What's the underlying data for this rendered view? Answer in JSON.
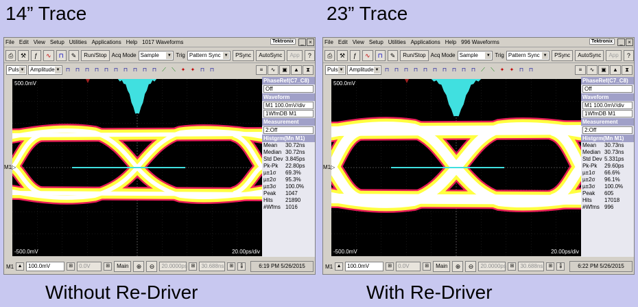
{
  "captions": {
    "left_top": "14” Trace",
    "right_top": "23” Trace",
    "left_bottom": "Without Re-Driver",
    "right_bottom": "With Re-Driver"
  },
  "colors": {
    "background": "#c8c8f0",
    "eye_hot": "#ffff40",
    "eye_core": "#ffffff",
    "eye_edge": "#ff2060",
    "histogram": "#40e0e0"
  },
  "menu": [
    "File",
    "Edit",
    "View",
    "Setup",
    "Utilities",
    "Applications",
    "Help"
  ],
  "brand": "Tektronix",
  "toolbar": {
    "run_stop": "Run/Stop",
    "acq_mode_label": "Acq Mode",
    "acq_mode_value": "Sample",
    "trig_label": "Trig",
    "trig_value": "Pattern Sync",
    "psync": "PSync",
    "autosync": "AutoSync",
    "app": "App",
    "help": "?"
  },
  "toolbar2": {
    "pulse": "Pulse",
    "amplitude": "Amplitude"
  },
  "scopes": [
    {
      "waveforms": "1017 Waveforms",
      "scale_top": "500.0mV",
      "scale_bottom": "-500.0mV",
      "time_div": "20.00ps/div",
      "panel": {
        "phaseref_title": "PhaseRef(C7_C8)",
        "phaseref_value": "Off",
        "waveform_title": "Waveform",
        "waveform_value": "M1 100.0mV/div",
        "wfmdb": "1WfmDB M1",
        "measurement_title": "Measurement",
        "measurement_value": "2:Off",
        "histogram_title": "Histgrm(Mn M1)",
        "stats": [
          {
            "k": "Mean",
            "v": "30.72ns"
          },
          {
            "k": "Median",
            "v": "30.72ns"
          },
          {
            "k": "Std Dev",
            "v": "3.845ps"
          },
          {
            "k": "Pk-Pk",
            "v": "22.80ps"
          },
          {
            "k": "µ±1σ",
            "v": "69.3%"
          },
          {
            "k": "µ±2σ",
            "v": "95.3%"
          },
          {
            "k": "µ±3σ",
            "v": "100.0%"
          },
          {
            "k": "Peak",
            "v": "1047"
          },
          {
            "k": "Hits",
            "v": "21890"
          },
          {
            "k": "#Wfms",
            "v": "1016"
          }
        ]
      },
      "bottom": {
        "m1": "M1",
        "vdiv": "100.0mV",
        "offset": "0.0V",
        "main": "Main",
        "time1": "20.0000ps",
        "time2": "30.688ns",
        "timestamp": "6:19 PM 5/26/2015"
      }
    },
    {
      "waveforms": "996 Waveforms",
      "scale_top": "500.0mV",
      "scale_bottom": "-500.0mV",
      "time_div": "20.00ps/div",
      "panel": {
        "phaseref_title": "PhaseRef(C7_C8)",
        "phaseref_value": "Off",
        "waveform_title": "Waveform",
        "waveform_value": "M1 100.0mV/div",
        "wfmdb": "1WfmDB M1",
        "measurement_title": "Measurement",
        "measurement_value": "2:Off",
        "histogram_title": "Histgrm(Mn M1)",
        "stats": [
          {
            "k": "Mean",
            "v": "30.73ns"
          },
          {
            "k": "Median",
            "v": "30.73ns"
          },
          {
            "k": "Std Dev",
            "v": "5.331ps"
          },
          {
            "k": "Pk-Pk",
            "v": "29.60ps"
          },
          {
            "k": "µ±1σ",
            "v": "66.6%"
          },
          {
            "k": "µ±2σ",
            "v": "96.1%"
          },
          {
            "k": "µ±3σ",
            "v": "100.0%"
          },
          {
            "k": "Peak",
            "v": "605"
          },
          {
            "k": "Hits",
            "v": "17018"
          },
          {
            "k": "#Wfms",
            "v": "996"
          }
        ]
      },
      "bottom": {
        "m1": "M1",
        "vdiv": "100.0mV",
        "offset": "0.0V",
        "main": "Main",
        "time1": "20.0000ps",
        "time2": "30.688ns",
        "timestamp": "6:22 PM 5/26/2015"
      }
    }
  ]
}
